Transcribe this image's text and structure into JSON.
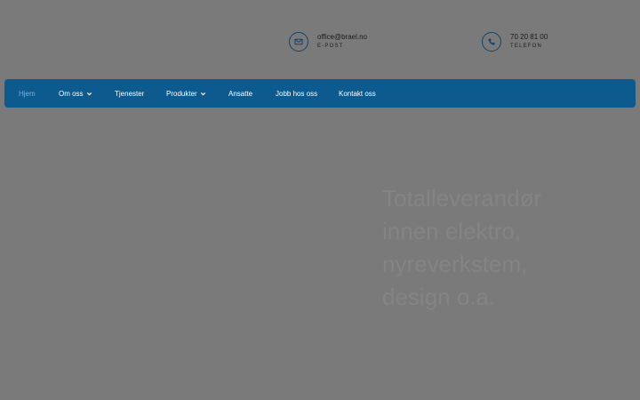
{
  "header": {
    "email": {
      "value": "office@brael.no",
      "label": "E-POST",
      "icon": "envelope-icon"
    },
    "phone": {
      "value": "70 20 81 00",
      "label": "TELEFON",
      "icon": "phone-icon"
    }
  },
  "nav": {
    "items": [
      {
        "label": "Hjem",
        "active": true
      },
      {
        "label": "Om oss",
        "dropdown": true
      },
      {
        "label": "Tjenester"
      },
      {
        "label": "Produkter",
        "dropdown": true
      },
      {
        "label": "Ansatte"
      },
      {
        "label": "Jobb hos oss"
      },
      {
        "label": "Kontakt oss"
      }
    ]
  },
  "hero": {
    "lines": [
      "Totalleverandør",
      "innen elektro,",
      "nyreverkstem,",
      "design o.a."
    ]
  },
  "colors": {
    "nav_background": "#0c5a8e",
    "active_nav": "#7fb0d4",
    "overlay": "#7a7a7a"
  }
}
